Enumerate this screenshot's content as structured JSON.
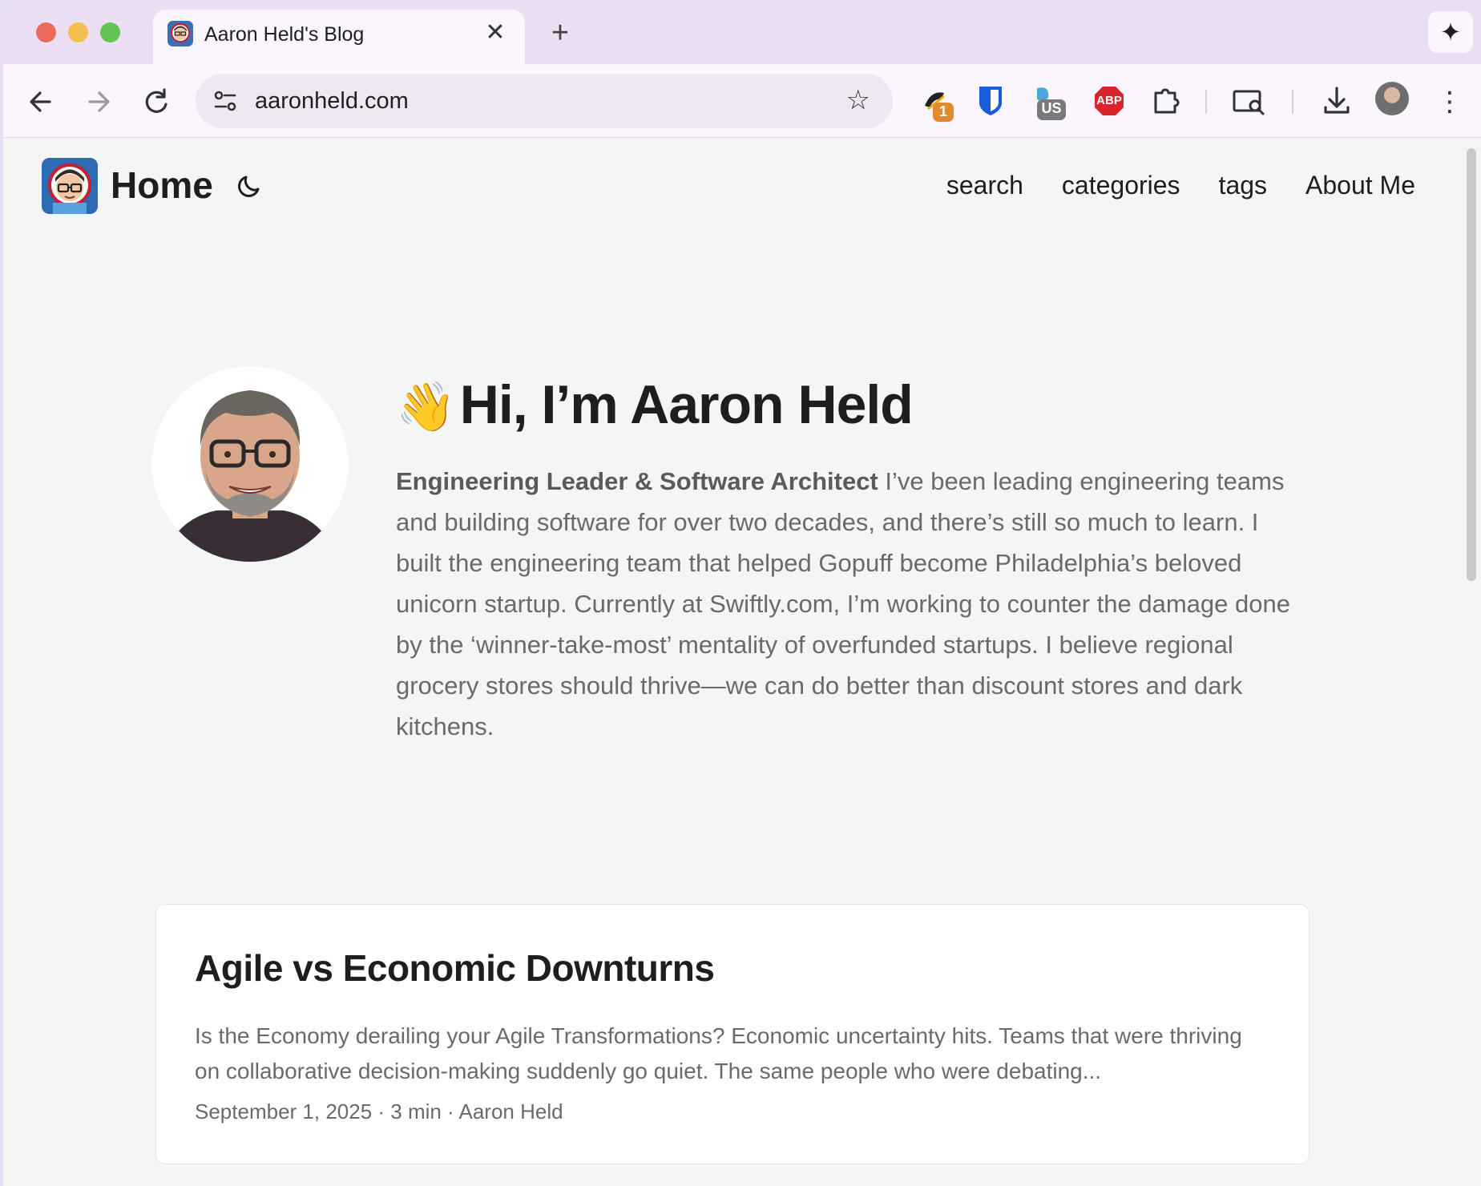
{
  "browser": {
    "tab_title": "Aaron Held's Blog",
    "url": "aaronheld.com",
    "tab_close": "✕",
    "new_tab": "+",
    "extensions": {
      "ext1_badge": "1",
      "ext3_badge": "US",
      "abp_label": "ABP"
    }
  },
  "site": {
    "home_label": "Home",
    "nav": [
      "search",
      "categories",
      "tags",
      "About Me"
    ]
  },
  "hero": {
    "wave": "👋",
    "title": "Hi, I’m Aaron Held",
    "bold_lead": "Engineering Leader & Software Architect",
    "body": " I’ve been leading engineering teams and building software for over two decades, and there’s still so much to learn. I built the engineering team that helped Gopuff become Philadelphia’s beloved unicorn startup. Currently at Swiftly.com, I’m working to counter the damage done by the ‘winner-take-most’ mentality of overfunded startups. I believe regional grocery stores should thrive—we can do better than discount stores and dark kitchens."
  },
  "posts": [
    {
      "title": "Agile vs Economic Downturns",
      "excerpt": "Is the Economy derailing your Agile Transformations? Economic uncertainty hits. Teams that were thriving on collaborative decision-making suddenly go quiet. The same people who were debating...",
      "meta": "September 1, 2025 · 3 min · Aaron Held"
    }
  ],
  "colors": {
    "tabstrip": "#ebdff4",
    "toolbar": "#fbf5fd",
    "page_bg": "#f5f5f5",
    "text_dark": "#1e1e1e",
    "text_muted": "#6a6a6a"
  }
}
